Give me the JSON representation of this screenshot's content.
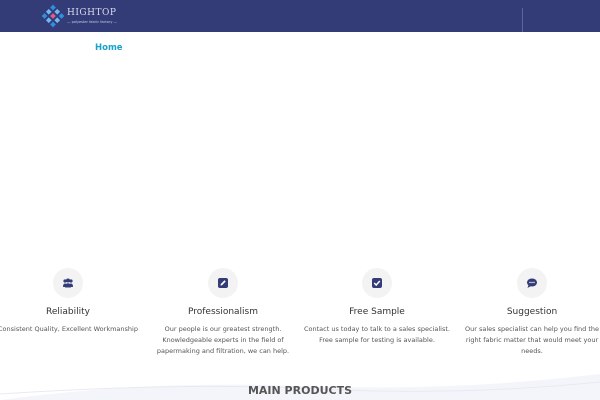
{
  "header": {
    "brand": "HIGHTOP",
    "tagline": "— polyester fabric factory —"
  },
  "breadcrumb": {
    "home": "Home"
  },
  "features": [
    {
      "icon": "users-icon",
      "title": "Reliability",
      "desc": "Consistent Quality, Excellent Workmanship"
    },
    {
      "icon": "edit-icon",
      "title": "Professionalism",
      "desc": "Our people is our greatest strength. Knowledgeable experts in the field of papermaking and filtration, we can help."
    },
    {
      "icon": "check-square-icon",
      "title": "Free Sample",
      "desc": "Contact us today to talk to a sales specialist. Free sample for testing is available."
    },
    {
      "icon": "comment-icon",
      "title": "Suggestion",
      "desc": "Our sales specialist can help you find the right fabric matter that would meet your needs."
    }
  ],
  "section": {
    "title": "MAIN PRODUCTS"
  },
  "colors": {
    "header_bg": "#343c78",
    "accent": "#1aa3c9",
    "icon": "#343c78"
  }
}
